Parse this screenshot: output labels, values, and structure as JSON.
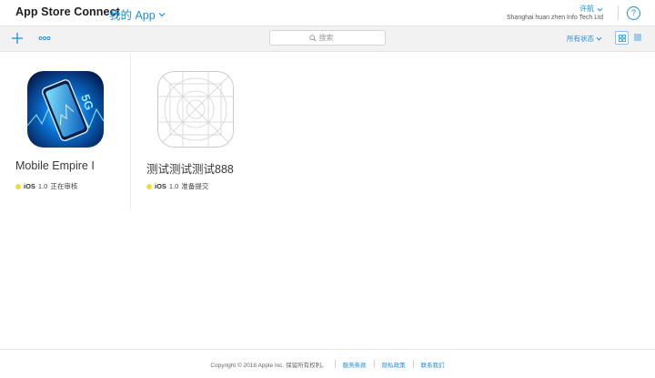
{
  "header": {
    "brand": "App Store Connect",
    "section_menu": "我的 App",
    "user_name": "许航",
    "organization": "Shanghai huan zhen Info Tech Ltd",
    "help": "?"
  },
  "toolbar": {
    "search_placeholder": "搜索",
    "filter_label": "所有状态",
    "add_icon": "plus-icon",
    "more_icon": "more-dots-icon",
    "view_grid_icon": "grid-view-icon",
    "view_list_icon": "list-view-icon"
  },
  "apps": [
    {
      "name": "Mobile Empire I",
      "platform": "iOS",
      "version": "1.0",
      "status": "正在审核",
      "status_color": "#f5d93b",
      "icon": "5g-phone-app-icon"
    },
    {
      "name": "测试测试测试888",
      "platform": "iOS",
      "version": "1.0",
      "status": "准备提交",
      "status_color": "#f5d93b",
      "icon": "placeholder-app-icon"
    }
  ],
  "footer": {
    "copyright": "Copyright © 2018 Apple Inc. 保留所有权利。",
    "links": [
      "服务条款",
      "隐私政策",
      "联系我们"
    ]
  },
  "colors": {
    "accent": "#1a8fe3",
    "toolbar_bg": "#f2f2f2"
  }
}
